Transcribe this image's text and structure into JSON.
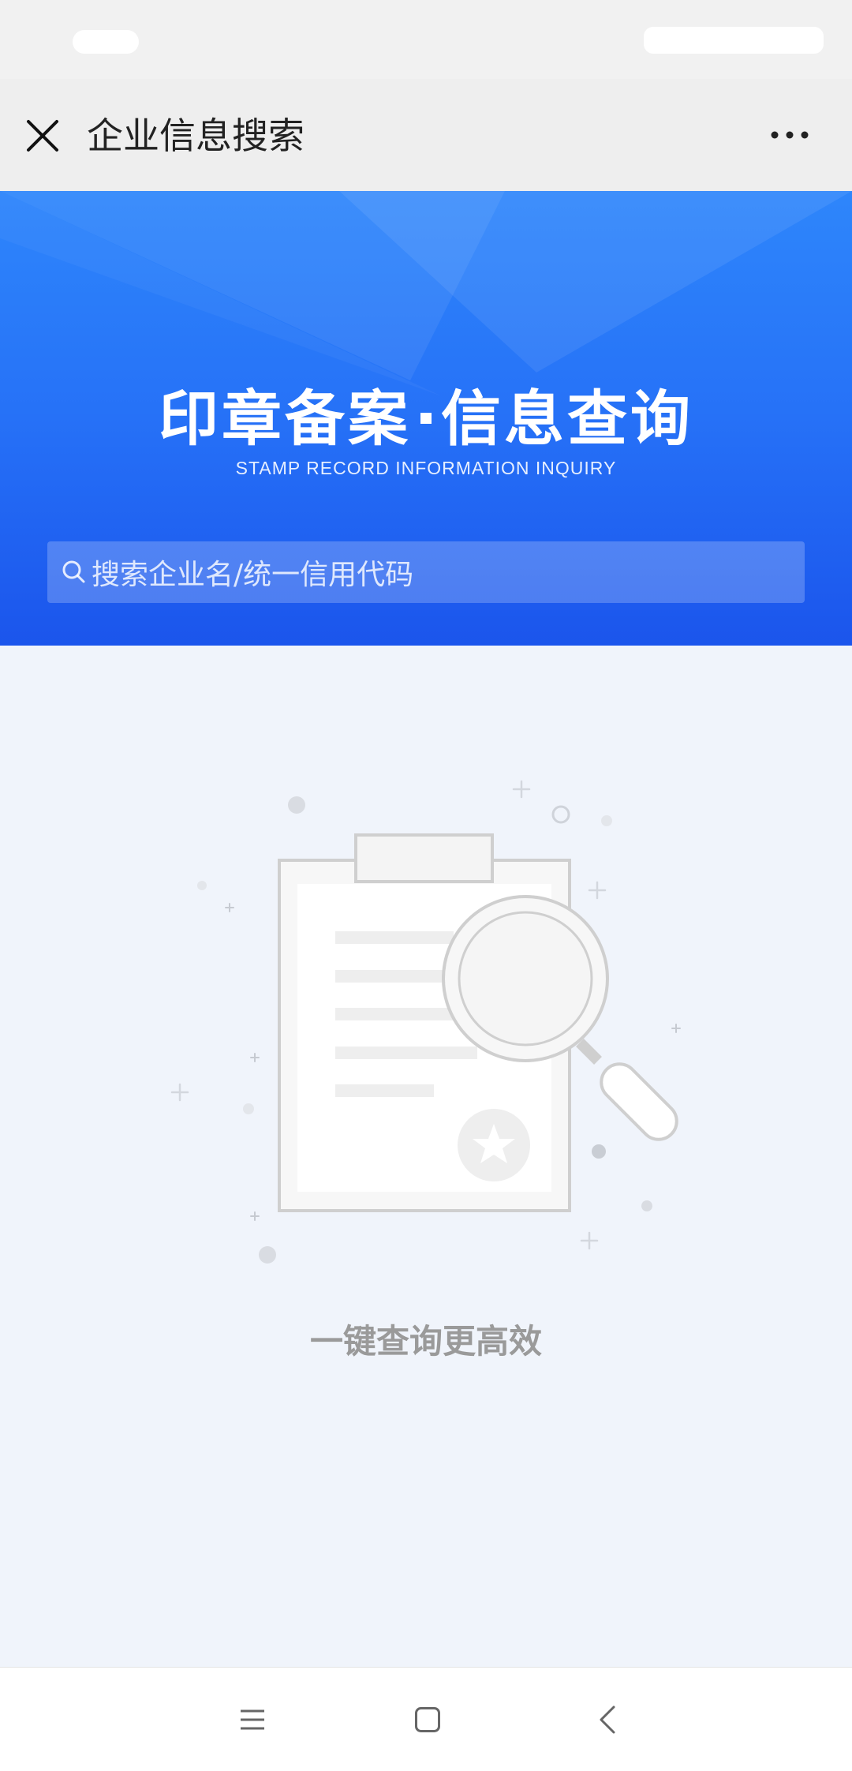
{
  "header": {
    "title": "企业信息搜索"
  },
  "banner": {
    "title_left": "印章备案",
    "title_right": "信息查询",
    "subtitle": "STAMP RECORD INFORMATION INQUIRY"
  },
  "search": {
    "placeholder": "搜索企业名/统一信用代码"
  },
  "empty_state": {
    "text": "一键查询更高效"
  },
  "icons": {
    "close": "close-icon",
    "more": "more-icon",
    "search": "search-icon",
    "menu": "menu-icon",
    "home": "home-icon",
    "back": "back-icon"
  },
  "colors": {
    "brand_blue": "#2671f7",
    "banner_top": "#2e86fb",
    "banner_bottom": "#1b55ec",
    "background": "#f0f4fb"
  }
}
